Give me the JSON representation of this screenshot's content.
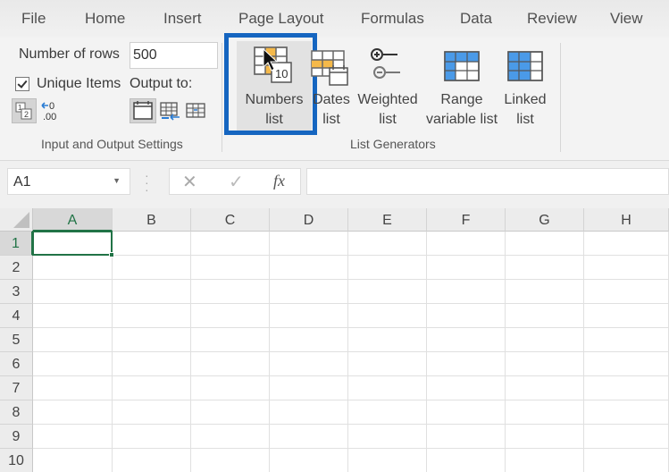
{
  "menu": {
    "tabs": [
      "File",
      "Home",
      "Insert",
      "Page Layout",
      "Formulas",
      "Data",
      "Review",
      "View"
    ]
  },
  "ribbon": {
    "input_output": {
      "rows_label": "Number of rows",
      "rows_value": "500",
      "unique_label": "Unique Items",
      "unique_checked": true,
      "output_label": "Output to:",
      "decimal_icon_text_top": "0",
      "decimal_icon_text_bottom": ".00",
      "group_label": "Input and Output Settings"
    },
    "list_generators": {
      "buttons": [
        {
          "line1": "Numbers",
          "line2": "list",
          "icon": "numbers-list-icon",
          "badge": "10"
        },
        {
          "line1": "Dates",
          "line2": "list",
          "icon": "dates-list-icon"
        },
        {
          "line1": "Weighted",
          "line2": "list",
          "icon": "weighted-list-icon"
        },
        {
          "line1": "Range",
          "line2": "variable list",
          "icon": "range-variable-list-icon"
        },
        {
          "line1": "Linked",
          "line2": "list",
          "icon": "linked-list-icon"
        }
      ],
      "group_label": "List Generators",
      "highlight_color": "#1565c0",
      "accent_orange": "#f5b94a",
      "accent_blue": "#4a9ae8"
    }
  },
  "formula_bar": {
    "name_box": "A1",
    "cancel_symbol": "✕",
    "enter_symbol": "✓",
    "fx_label": "fx",
    "formula_value": ""
  },
  "sheet": {
    "columns": [
      "A",
      "B",
      "C",
      "D",
      "E",
      "F",
      "G",
      "H"
    ],
    "rows": [
      "1",
      "2",
      "3",
      "4",
      "5",
      "6",
      "7",
      "8",
      "9",
      "10"
    ],
    "active_cell": "A1",
    "selection_color": "#217346"
  }
}
